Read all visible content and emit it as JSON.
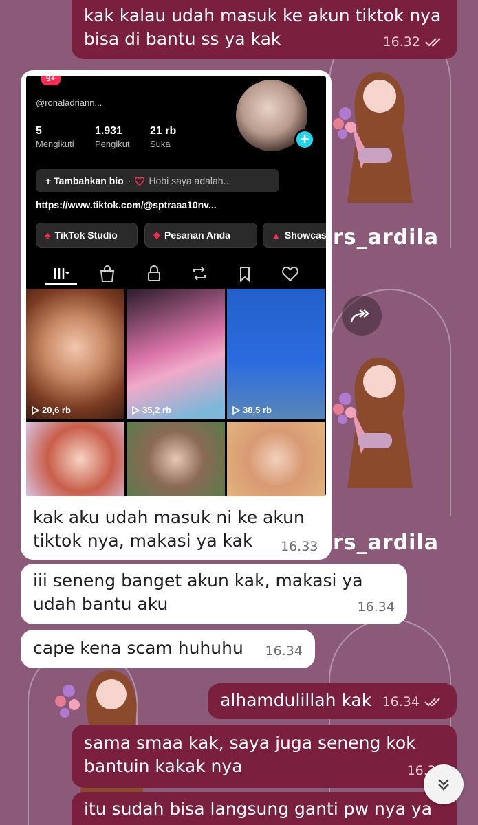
{
  "wallpaper": {
    "watermark": "rs_ardila"
  },
  "messages": [
    {
      "text_line1": "kak kalau udah masuk ke akun tiktok nya",
      "text_line2": "bisa di bantu ss ya kak",
      "time": "16.32"
    },
    {
      "caption_line1": "kak aku udah masuk ni ke akun",
      "caption_line2": "tiktok nya, makasi ya kak",
      "time": "16.33"
    },
    {
      "text_line1": "iii seneng banget akun kak,  makasi ya",
      "text_line2": "udah bantu aku",
      "time": "16.34"
    },
    {
      "text_line1": "cape kena scam huhuhu",
      "time": "16.34"
    },
    {
      "text_line1": "alhamdulillah kak",
      "time": "16.34"
    },
    {
      "text_line1": "sama smaa kak, saya juga seneng kok",
      "text_line2": "bantuin kakak nya",
      "time": "16.34"
    },
    {
      "text_line1": "itu sudah bisa langsung ganti pw nya ya"
    }
  ],
  "tiktok": {
    "badge": "9+",
    "username": "@ronaladriann...",
    "stats": [
      {
        "num": "5",
        "label": "Mengikuti"
      },
      {
        "num": "1.931",
        "label": "Pengikut"
      },
      {
        "num": "21 rb",
        "label": "Suka"
      }
    ],
    "bio_button": "+ Tambahkan bio",
    "bio_dot": "·",
    "bio_hobby": "Hobi saya adalah...",
    "link": "https://www.tiktok.com/@sptraaa10nv...",
    "buttons": [
      "TikTok Studio",
      "Pesanan Anda",
      "Showcase"
    ],
    "views": [
      "20,6 rb",
      "35,2 rb",
      "38,5 rb"
    ]
  },
  "colors": {
    "outgoing_bubble": "#7a1f3d",
    "incoming_bubble": "#ffffff",
    "background": "#8a5a78"
  }
}
